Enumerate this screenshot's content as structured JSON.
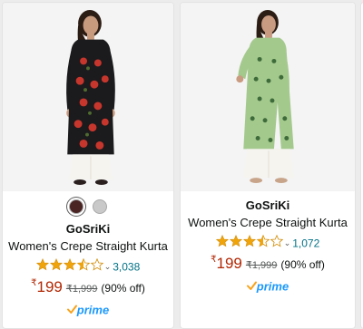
{
  "products": [
    {
      "brand": "GoSriKi",
      "title": "Women's Crepe Straight Kurta",
      "rating": 3.5,
      "rating_count": "3,038",
      "currency": "₹",
      "price": "199",
      "mrp": "₹1,999",
      "discount": "(90% off)",
      "prime_label": "prime",
      "kurta_color": "#1b1a1d",
      "print_color": "#c7362c",
      "swatches": [
        "#4a2323",
        "#c9c9c9"
      ],
      "selected_swatch": 0
    },
    {
      "brand": "GoSriKi",
      "title": "Women's Crepe Straight Kurta",
      "rating": 3.5,
      "rating_count": "1,072",
      "currency": "₹",
      "price": "199",
      "mrp": "₹1,999",
      "discount": "(90% off)",
      "prime_label": "prime",
      "kurta_color": "#a4c98d",
      "print_color": "#3e6b3a"
    }
  ],
  "colors": {
    "star": "#f0a40c",
    "price": "#b12704",
    "link": "#007185",
    "prime": "#1a98ff"
  }
}
